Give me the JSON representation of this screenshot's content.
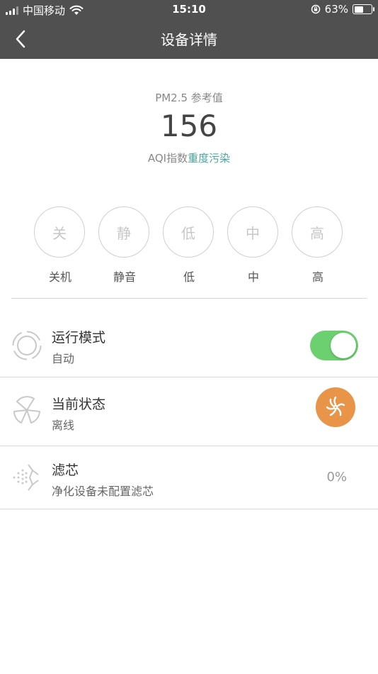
{
  "status_bar": {
    "carrier": "中国移动",
    "time": "15:10",
    "battery": "63%",
    "battery_level": 0.63
  },
  "nav": {
    "title": "设备详情"
  },
  "pm": {
    "label": "PM2.5 参考值",
    "value": "156",
    "aqi_prefix": "AQI指数",
    "aqi_level": "重度污染"
  },
  "speeds": [
    {
      "glyph": "关",
      "label": "关机"
    },
    {
      "glyph": "静",
      "label": "静音"
    },
    {
      "glyph": "低",
      "label": "低"
    },
    {
      "glyph": "中",
      "label": "中"
    },
    {
      "glyph": "高",
      "label": "高"
    }
  ],
  "rows": {
    "mode": {
      "title": "运行模式",
      "value": "自动",
      "toggle_on": true
    },
    "state": {
      "title": "当前状态",
      "value": "离线"
    },
    "filter": {
      "title": "滤芯",
      "value": "净化设备未配置滤芯",
      "percent": "0%"
    }
  },
  "colors": {
    "header_bg": "#505050",
    "aqi_level": "#4ba89e",
    "toggle_on": "#6cd06f",
    "state_button": "#e8954a"
  }
}
